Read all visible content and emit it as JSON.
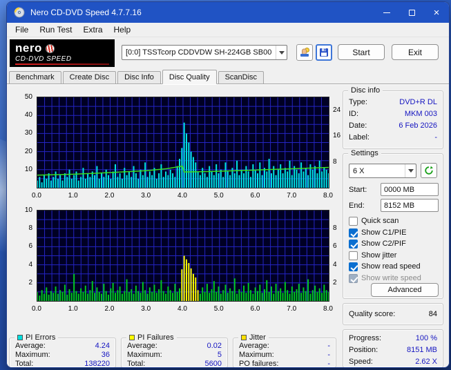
{
  "window": {
    "title": "Nero CD-DVD Speed 4.7.7.16"
  },
  "menu": {
    "items": [
      {
        "label": "File"
      },
      {
        "label": "Run Test"
      },
      {
        "label": "Extra"
      },
      {
        "label": "Help"
      }
    ]
  },
  "toolbar": {
    "logo_line1": "nero",
    "logo_line2": "CD-DVD SPEED",
    "drive_select": "[0:0] TSSTcorp CDDVDW SH-224GB SB00",
    "start_label": "Start",
    "exit_label": "Exit"
  },
  "tabs": [
    {
      "label": "Benchmark"
    },
    {
      "label": "Create Disc"
    },
    {
      "label": "Disc Info"
    },
    {
      "label": "Disc Quality"
    },
    {
      "label": "ScanDisc"
    }
  ],
  "disc_info": {
    "title": "Disc info",
    "rows": [
      {
        "label": "Type:",
        "value": "DVD+R DL"
      },
      {
        "label": "ID:",
        "value": "MKM 003"
      },
      {
        "label": "Date:",
        "value": "6 Feb 2026"
      },
      {
        "label": "Label:",
        "value": "-"
      }
    ]
  },
  "settings": {
    "title": "Settings",
    "speed": "6 X",
    "start_label": "Start:",
    "start_value": "0000 MB",
    "end_label": "End:",
    "end_value": "8152 MB",
    "checkboxes": [
      {
        "label": "Quick scan",
        "checked": false,
        "disabled": false
      },
      {
        "label": "Show C1/PIE",
        "checked": true,
        "disabled": false
      },
      {
        "label": "Show C2/PIF",
        "checked": true,
        "disabled": false
      },
      {
        "label": "Show jitter",
        "checked": false,
        "disabled": false
      },
      {
        "label": "Show read speed",
        "checked": true,
        "disabled": false
      },
      {
        "label": "Show write speed",
        "checked": true,
        "disabled": true
      }
    ],
    "advanced_label": "Advanced"
  },
  "quality": {
    "label": "Quality score:",
    "value": "84"
  },
  "progress": {
    "rows": [
      {
        "label": "Progress:",
        "value": "100 %"
      },
      {
        "label": "Position:",
        "value": "8151 MB"
      },
      {
        "label": "Speed:",
        "value": "2.62 X"
      }
    ]
  },
  "stats": [
    {
      "title": "PI Errors",
      "swatch": "#00dede",
      "rows": [
        {
          "label": "Average:",
          "value": "4.24"
        },
        {
          "label": "Maximum:",
          "value": "36"
        },
        {
          "label": "Total:",
          "value": "138220"
        }
      ]
    },
    {
      "title": "PI Failures",
      "swatch": "#ffff00",
      "rows": [
        {
          "label": "Average:",
          "value": "0.02"
        },
        {
          "label": "Maximum:",
          "value": "5"
        },
        {
          "label": "Total:",
          "value": "5600"
        }
      ]
    },
    {
      "title": "Jitter",
      "swatch": "#ffe000",
      "rows": [
        {
          "label": "Average:",
          "value": "-"
        },
        {
          "label": "Maximum:",
          "value": "-"
        },
        {
          "label": "PO failures:",
          "value": "-"
        }
      ]
    }
  ],
  "chart_data": [
    {
      "type": "bar",
      "title": "PI Errors",
      "x_max": 8.0,
      "x_ticks": [
        "0.0",
        "1.0",
        "2.0",
        "3.0",
        "4.0",
        "5.0",
        "6.0",
        "7.0",
        "8.0"
      ],
      "ylim": [
        0,
        50
      ],
      "left_ticks": [
        50,
        40,
        30,
        20,
        10
      ],
      "right_ticks": [
        24,
        16,
        8
      ],
      "right_ylim": [
        0,
        28
      ],
      "grid": {
        "x_step": 0.2,
        "y_step": 5,
        "color": "#2424c4",
        "bg": "#000024"
      },
      "series": [
        {
          "name": "PI Errors",
          "type": "spikes",
          "color": "#00e6e6",
          "values": [
            4,
            6,
            3,
            7,
            5,
            8,
            4,
            6,
            9,
            5,
            7,
            4,
            8,
            6,
            10,
            5,
            7,
            9,
            4,
            6,
            11,
            5,
            8,
            6,
            9,
            7,
            12,
            5,
            8,
            6,
            10,
            7,
            5,
            9,
            13,
            6,
            8,
            5,
            11,
            7,
            9,
            6,
            12,
            8,
            5,
            10,
            7,
            14,
            6,
            9,
            7,
            11,
            5,
            8,
            13,
            6,
            9,
            7,
            10,
            8,
            6,
            12,
            16,
            22,
            36,
            30,
            25,
            20,
            17,
            14,
            9,
            7,
            11,
            8,
            6,
            12,
            9,
            7,
            13,
            8,
            10,
            6,
            14,
            9,
            7,
            11,
            8,
            15,
            7,
            10,
            8,
            12,
            9,
            6,
            13,
            10,
            8,
            14,
            7,
            11,
            9,
            16,
            8,
            12,
            7,
            10,
            13,
            8,
            11,
            9,
            15,
            7,
            12,
            10,
            8,
            14,
            9,
            11,
            7,
            13,
            10,
            12,
            8,
            15,
            9,
            11,
            10,
            8
          ]
        },
        {
          "name": "Read speed",
          "type": "line",
          "axis": "right",
          "color": "#3cdd1e",
          "points": [
            [
              0,
              3.9
            ],
            [
              1,
              4.2
            ],
            [
              2,
              4.7
            ],
            [
              3,
              5.3
            ],
            [
              3.55,
              5.9
            ],
            [
              3.98,
              6.7
            ],
            [
              4.03,
              4.9
            ],
            [
              4.6,
              5.0
            ],
            [
              5.5,
              5.3
            ],
            [
              6.5,
              5.7
            ],
            [
              7.3,
              6.0
            ],
            [
              8,
              6.3
            ]
          ]
        }
      ]
    },
    {
      "type": "bar",
      "title": "PI Failures",
      "x_max": 8.0,
      "x_ticks": [
        "0.0",
        "1.0",
        "2.0",
        "3.0",
        "4.0",
        "5.0",
        "6.0",
        "7.0",
        "8.0"
      ],
      "ylim": [
        0,
        10
      ],
      "left_ticks": [
        10,
        8,
        6,
        4,
        2
      ],
      "right_ticks": [
        8,
        6,
        4,
        2
      ],
      "right_ylim": [
        0,
        10
      ],
      "grid": {
        "x_step": 0.2,
        "y_step": 1,
        "color": "#2424c4",
        "bg": "#000024"
      },
      "series": [
        {
          "name": "PI Failures",
          "type": "spikes",
          "color": "#00c81e",
          "highlight": {
            "x0": 3.94,
            "x1": 4.42,
            "color": "#ffff00"
          },
          "values": [
            1,
            0.6,
            1.2,
            0.8,
            1.5,
            0.7,
            1.1,
            0.9,
            1.6,
            0.8,
            1.2,
            1,
            1.8,
            0.7,
            1.3,
            0.9,
            3,
            1.1,
            0.8,
            1.4,
            1,
            1.7,
            0.8,
            1.2,
            2.2,
            0.9,
            1.5,
            1,
            0.8,
            1.9,
            1.1,
            0.7,
            1.4,
            2,
            0.9,
            1.2,
            1.6,
            0.8,
            1.1,
            2.4,
            1,
            1.3,
            0.8,
            1.7,
            1.1,
            0.9,
            2.1,
            1.2,
            0.8,
            1.5,
            1,
            1.8,
            0.9,
            1.3,
            2.3,
            1.1,
            0.8,
            1.6,
            1.2,
            0.9,
            1.9,
            1,
            1.4,
            3.5,
            5,
            4.6,
            4.2,
            3.6,
            3,
            2.6,
            1.2,
            0.8,
            1.5,
            1,
            1.9,
            0.9,
            1.3,
            2.2,
            1,
            1.6,
            0.8,
            1.2,
            1.8,
            0.9,
            1.4,
            1.1,
            2.5,
            0.8,
            1.3,
            1,
            1.7,
            0.9,
            2,
            1.2,
            0.8,
            1.5,
            1.1,
            1.8,
            0.9,
            1.3,
            2.3,
            1,
            1.6,
            0.8,
            1.9,
            1.1,
            1.4,
            0.9,
            2.1,
            1.2,
            0.8,
            1.6,
            1,
            1.3,
            1.9,
            0.9,
            1.5,
            1.1,
            2.4,
            0.8,
            1.2,
            1.7,
            1,
            1.4,
            0.9,
            1.8,
            1.2,
            1
          ]
        }
      ]
    }
  ]
}
